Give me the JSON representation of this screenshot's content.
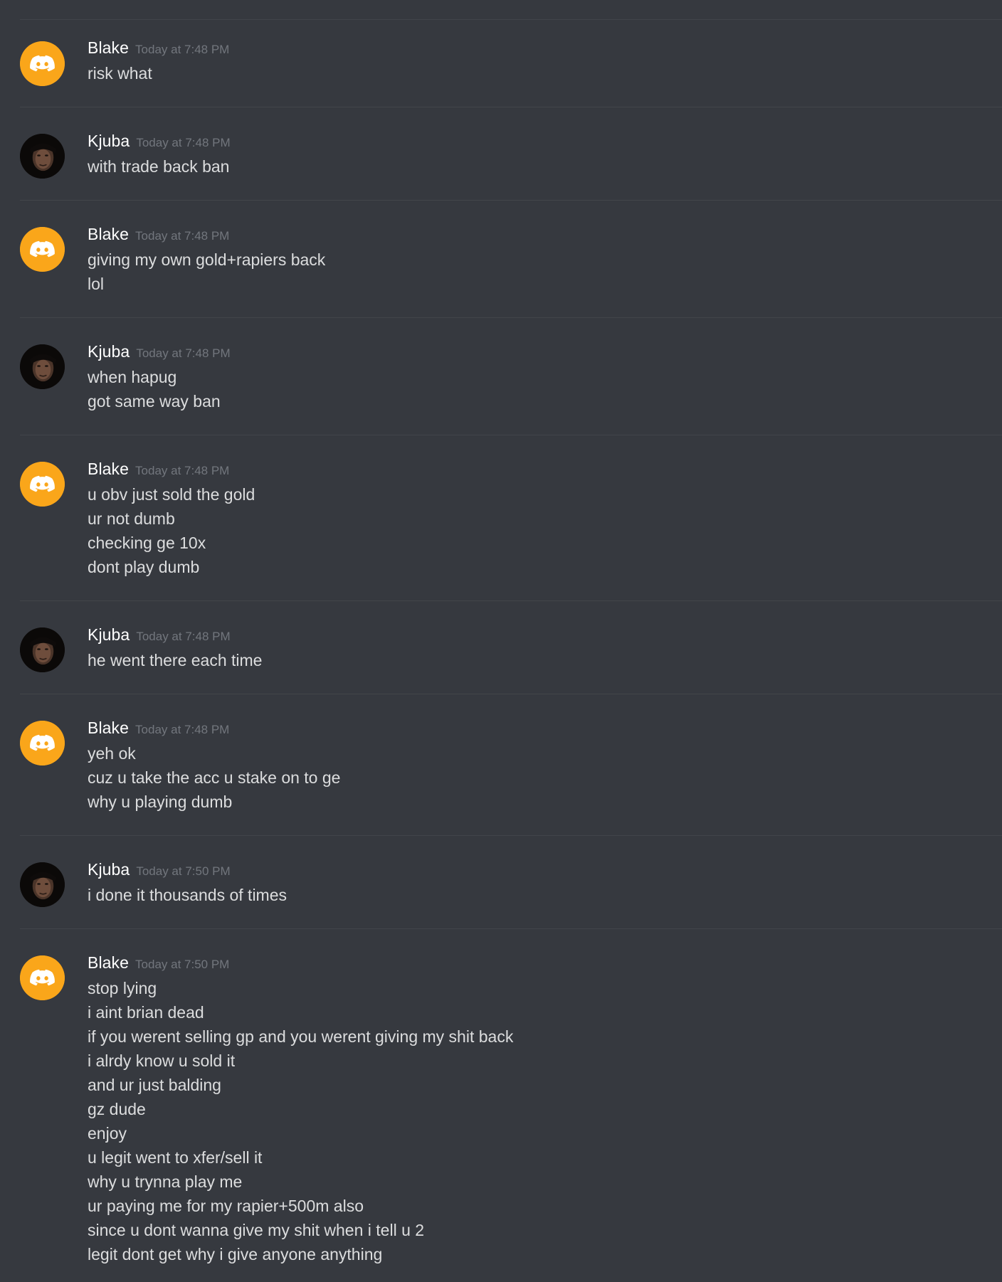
{
  "messages": [
    {
      "author": "Blake",
      "avatar": "discord-logo-icon",
      "timestamp": "Today at 7:48 PM",
      "lines": [
        "risk what"
      ]
    },
    {
      "author": "Kjuba",
      "avatar": "user-photo-avatar",
      "timestamp": "Today at 7:48 PM",
      "lines": [
        "with trade back ban"
      ]
    },
    {
      "author": "Blake",
      "avatar": "discord-logo-icon",
      "timestamp": "Today at 7:48 PM",
      "lines": [
        "giving my own gold+rapiers back",
        "lol"
      ]
    },
    {
      "author": "Kjuba",
      "avatar": "user-photo-avatar",
      "timestamp": "Today at 7:48 PM",
      "lines": [
        "when hapug",
        "got same way ban"
      ]
    },
    {
      "author": "Blake",
      "avatar": "discord-logo-icon",
      "timestamp": "Today at 7:48 PM",
      "lines": [
        "u obv just sold the gold",
        "ur not dumb",
        "checking ge 10x",
        "dont play dumb"
      ]
    },
    {
      "author": "Kjuba",
      "avatar": "user-photo-avatar",
      "timestamp": "Today at 7:48 PM",
      "lines": [
        "he went there each time"
      ]
    },
    {
      "author": "Blake",
      "avatar": "discord-logo-icon",
      "timestamp": "Today at 7:48 PM",
      "lines": [
        "yeh ok",
        "cuz u take the acc u stake on to ge",
        "why u playing dumb"
      ]
    },
    {
      "author": "Kjuba",
      "avatar": "user-photo-avatar",
      "timestamp": "Today at 7:50 PM",
      "lines": [
        "i done it thousands of times"
      ]
    },
    {
      "author": "Blake",
      "avatar": "discord-logo-icon",
      "timestamp": "Today at 7:50 PM",
      "lines": [
        "stop lying",
        "i aint brian dead",
        "if you werent selling gp and you werent giving my shit back",
        "i alrdy know u sold it",
        "and ur just balding",
        "gz dude",
        "enjoy",
        "u legit went to xfer/sell it",
        "why u trynna play me",
        "ur paying me for my rapier+500m also",
        "since u dont wanna give my shit when i tell u 2",
        "legit dont get why i give anyone anything"
      ]
    }
  ],
  "colors": {
    "background": "#36393f",
    "divider": "#42454a",
    "username": "#ffffff",
    "timestamp": "#72767d",
    "message_text": "#dcddde",
    "discord_avatar": "#faa61a"
  }
}
